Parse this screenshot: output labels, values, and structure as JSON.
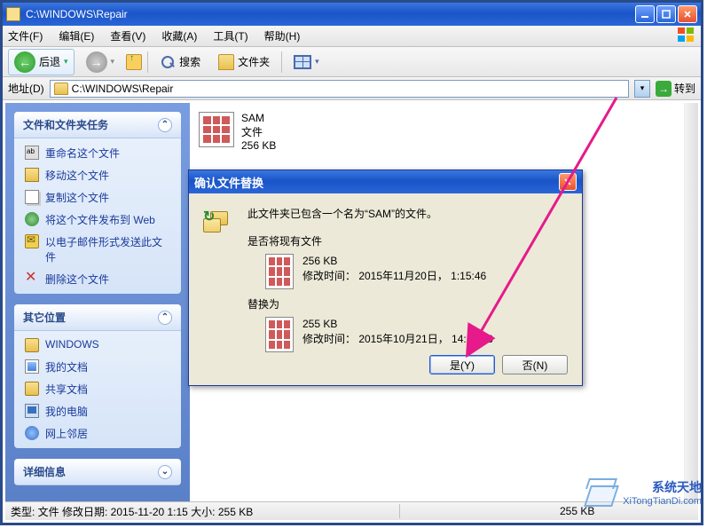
{
  "window": {
    "title": "C:\\WINDOWS\\Repair",
    "minimize_tip": "minimize",
    "maximize_tip": "maximize",
    "close_tip": "close"
  },
  "menu": {
    "file": "文件(F)",
    "edit": "编辑(E)",
    "view": "查看(V)",
    "favorites": "收藏(A)",
    "tools": "工具(T)",
    "help": "帮助(H)"
  },
  "toolbar": {
    "back": "后退",
    "search": "搜索",
    "folders": "文件夹"
  },
  "address": {
    "label": "地址(D)",
    "value": "C:\\WINDOWS\\Repair",
    "go": "转到"
  },
  "sidebar": {
    "tasks": {
      "title": "文件和文件夹任务",
      "items": [
        "重命名这个文件",
        "移动这个文件",
        "复制这个文件",
        "将这个文件发布到 Web",
        "以电子邮件形式发送此文件",
        "删除这个文件"
      ]
    },
    "places": {
      "title": "其它位置",
      "items": [
        "WINDOWS",
        "我的文档",
        "共享文档",
        "我的电脑",
        "网上邻居"
      ]
    },
    "details": {
      "title": "详细信息"
    }
  },
  "file": {
    "name": "SAM",
    "type": "文件",
    "size": "256 KB"
  },
  "dialog": {
    "title": "确认文件替换",
    "message": "此文件夹已包含一个名为“SAM”的文件。",
    "question": "是否将现有文件",
    "existing": {
      "size": "256 KB",
      "modified": "修改时间： 2015年11月20日， 1:15:46"
    },
    "replace_with": "替换为",
    "newfile": {
      "size": "255 KB",
      "modified": "修改时间： 2015年10月21日， 14:13:13"
    },
    "yes": "是(Y)",
    "no": "否(N)"
  },
  "statusbar": {
    "left": "类型: 文件 修改日期: 2015-11-20 1:15 大小: 255 KB",
    "right": "255 KB"
  },
  "watermark": {
    "brand": "系统天地",
    "url": "XiTongTianDi.com"
  }
}
